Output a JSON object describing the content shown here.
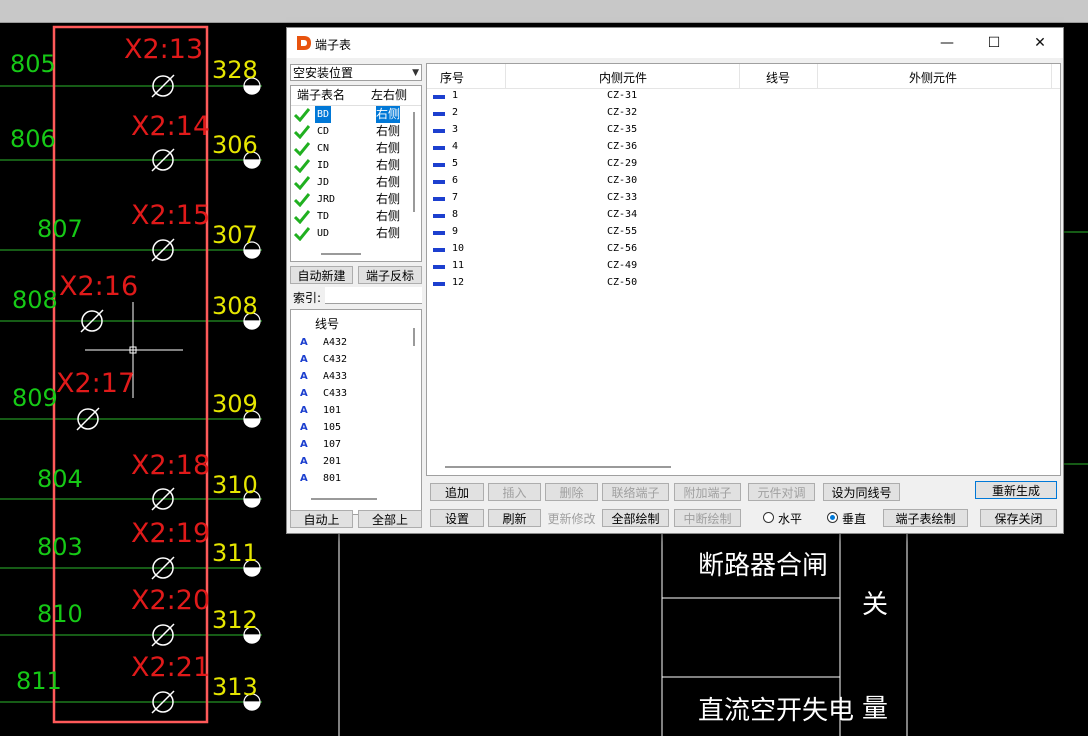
{
  "cad": {
    "left_labels": [
      "805",
      "806",
      "807",
      "808",
      "809",
      "804",
      "803",
      "810",
      "811"
    ],
    "right_labels": [
      "328",
      "306",
      "307",
      "308",
      "309",
      "310",
      "311",
      "312",
      "313"
    ],
    "terminal_labels": [
      "X2:13",
      "X2:14",
      "X2:15",
      "X2:16",
      "X2:17",
      "X2:18",
      "X2:19",
      "X2:20",
      "X2:21"
    ],
    "table_texts": [
      "断路器合闸",
      "关",
      "直流空开失电",
      "量"
    ],
    "colors": {
      "left": "#16c916",
      "right": "#e6e600",
      "terminal": "#e01a1a",
      "box": "#ff5a5a"
    }
  },
  "dialog": {
    "title": "端子表",
    "location_combo": "空安装位置",
    "terminal_list": {
      "header_name": "端子表名",
      "header_side": "左右侧",
      "items": [
        {
          "name": "BD",
          "side": "右侧"
        },
        {
          "name": "CD",
          "side": "右侧"
        },
        {
          "name": "CN",
          "side": "右侧"
        },
        {
          "name": "ID",
          "side": "右侧"
        },
        {
          "name": "JD",
          "side": "右侧"
        },
        {
          "name": "JRD",
          "side": "右侧"
        },
        {
          "name": "TD",
          "side": "右侧"
        },
        {
          "name": "UD",
          "side": "右侧"
        }
      ]
    },
    "auto_new": "自动新建",
    "terminal_reverse": "端子反标",
    "index_label": "索引:",
    "wire_list": {
      "header": "线号",
      "items": [
        "A432",
        "C432",
        "A433",
        "C433",
        "101",
        "105",
        "107",
        "201",
        "801"
      ]
    },
    "auto_up": "自动上",
    "all_up": "全部上",
    "grid": {
      "headers": [
        "序号",
        "内侧元件",
        "线号",
        "外侧元件"
      ],
      "rows": [
        {
          "seq": "1",
          "inner": "CZ-31"
        },
        {
          "seq": "2",
          "inner": "CZ-32"
        },
        {
          "seq": "3",
          "inner": "CZ-35"
        },
        {
          "seq": "4",
          "inner": "CZ-36"
        },
        {
          "seq": "5",
          "inner": "CZ-29"
        },
        {
          "seq": "6",
          "inner": "CZ-30"
        },
        {
          "seq": "7",
          "inner": "CZ-33"
        },
        {
          "seq": "8",
          "inner": "CZ-34"
        },
        {
          "seq": "9",
          "inner": "CZ-55"
        },
        {
          "seq": "10",
          "inner": "CZ-56"
        },
        {
          "seq": "11",
          "inner": "CZ-49"
        },
        {
          "seq": "12",
          "inner": "CZ-50"
        }
      ]
    },
    "buttons_row1": {
      "add": "追加",
      "insert": "插入",
      "delete": "删除",
      "link": "联络端子",
      "attach": "附加端子",
      "swap": "元件对调",
      "same_wire": "设为同线号",
      "regenerate": "重新生成"
    },
    "buttons_row2": {
      "settings": "设置",
      "refresh": "刷新",
      "update": "更新修改",
      "draw_all": "全部绘制",
      "draw_break": "中断绘制",
      "horizontal": "水平",
      "vertical": "垂直",
      "draw_table": "端子表绘制",
      "save_close": "保存关闭"
    },
    "orientation_selected": "vertical",
    "accent": "#0078d7"
  }
}
